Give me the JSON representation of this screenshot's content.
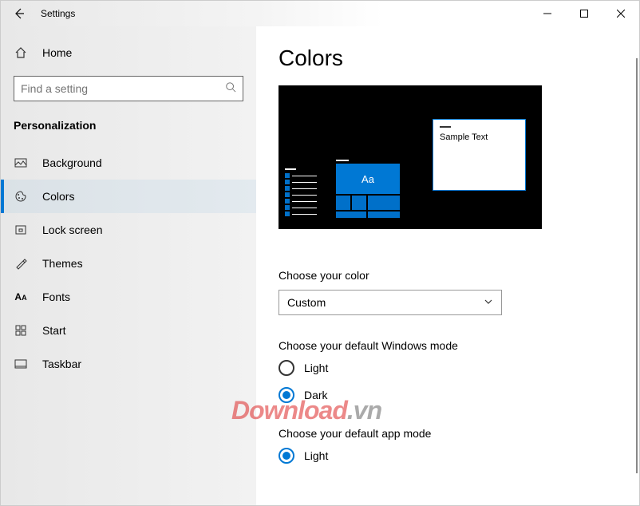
{
  "titlebar": {
    "app_name": "Settings"
  },
  "sidebar": {
    "home": "Home",
    "search_placeholder": "Find a setting",
    "category": "Personalization",
    "items": [
      {
        "label": "Background"
      },
      {
        "label": "Colors"
      },
      {
        "label": "Lock screen"
      },
      {
        "label": "Themes"
      },
      {
        "label": "Fonts"
      },
      {
        "label": "Start"
      },
      {
        "label": "Taskbar"
      }
    ]
  },
  "page": {
    "title": "Colors",
    "preview": {
      "sample_text": "Sample Text",
      "tile_glyph": "Aa"
    },
    "choose_color": {
      "label": "Choose your color",
      "selected": "Custom"
    },
    "windows_mode": {
      "label": "Choose your default Windows mode",
      "options": {
        "light": "Light",
        "dark": "Dark"
      },
      "selected": "dark"
    },
    "app_mode": {
      "label": "Choose your default app mode",
      "options": {
        "light": "Light"
      },
      "selected": "light"
    }
  },
  "watermark": {
    "text_main": "Download",
    "text_suffix": ".vn"
  }
}
